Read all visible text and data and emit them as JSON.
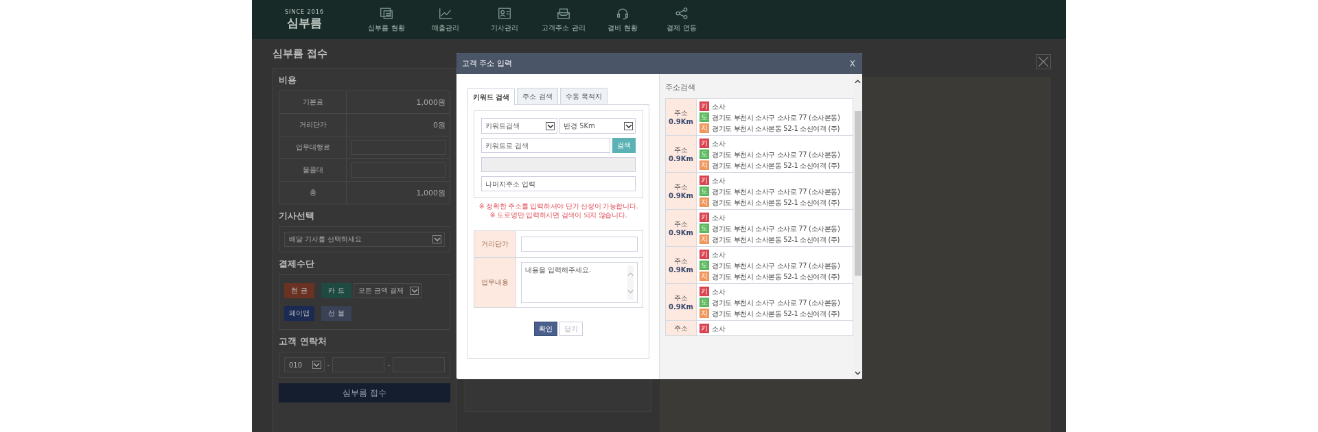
{
  "header": {
    "logo": {
      "since": "SINCE 2016",
      "name": "심부름"
    },
    "nav": [
      {
        "label": "심부름 현황",
        "kind": "board"
      },
      {
        "label": "매출관리",
        "kind": "chart"
      },
      {
        "label": "기사관리",
        "kind": "card"
      },
      {
        "label": "고객주소 관리",
        "kind": "inbox"
      },
      {
        "label": "결비 현황",
        "kind": "headset"
      },
      {
        "label": "결제 연동",
        "kind": "share"
      }
    ]
  },
  "page": {
    "title": "심부름 접수",
    "cost": {
      "heading": "비용",
      "rows": [
        {
          "label": "기본료",
          "kind": "value",
          "value": "1,000원"
        },
        {
          "label": "거리단가",
          "kind": "value",
          "value": "0원"
        },
        {
          "label": "업무대행료",
          "kind": "input"
        },
        {
          "label": "물품대",
          "kind": "input"
        },
        {
          "label": "총",
          "kind": "value",
          "value": "1,000원"
        }
      ]
    },
    "driver": {
      "heading": "기사선택",
      "select": "배달 기사를 선택하세요"
    },
    "payment": {
      "heading": "결제수단",
      "rows": [
        [
          {
            "kind": "button",
            "label": "현 금",
            "color": "#6a3222"
          },
          {
            "kind": "button",
            "label": "카 드",
            "color": "#1f4a42"
          },
          {
            "kind": "select",
            "label": "모든 금액 결제"
          }
        ],
        [
          {
            "kind": "button",
            "label": "페이앱",
            "color": "#1b2a52"
          },
          {
            "kind": "button",
            "label": "선 불",
            "color": "#3a4256"
          }
        ]
      ]
    },
    "contact": {
      "heading": "고객 연락처",
      "prefix": "010",
      "separators": [
        "-",
        "-"
      ]
    },
    "submit": "심부름 접수"
  },
  "modal": {
    "title": "고객 주소 입력",
    "close": "X",
    "tabs": [
      {
        "label": "키워드 검색",
        "selected": true
      },
      {
        "label": "주소 검색",
        "selected": false
      },
      {
        "label": "수동 목적지",
        "selected": false
      }
    ],
    "search": {
      "type_select": "키워드검색",
      "radius_select": "반경 5Km",
      "keyword": {
        "placeholder": "키워드로 검색"
      },
      "search_button": "검색",
      "address_display": {
        "disabled": true
      },
      "detail": {
        "placeholder": "나머지주소 입력"
      }
    },
    "notices": [
      "※ 정확한 주소를 입력하셔야 단가 산정이 가능합니다.",
      "※ 도로명만 입력하시면 검색이 되지 않습니다."
    ],
    "form": [
      {
        "label": "거리단가",
        "kind": "input"
      },
      {
        "label": "업무내용",
        "kind": "textarea",
        "placeholder": "내용을 입력해주세요."
      }
    ],
    "buttons": [
      {
        "label": "확인",
        "kind": "primary"
      },
      {
        "label": "닫기",
        "kind": "secondary"
      }
    ],
    "results": {
      "heading": "주소검색",
      "items": [
        {
          "label": "주소",
          "distance": "0.9Km",
          "lines": [
            {
              "badge": "키",
              "color": "#d9434f",
              "text": "소사"
            },
            {
              "badge": "도",
              "color": "#5cb85c",
              "text": "경기도 부천시 소사구 소사로 77 (소사본동)"
            },
            {
              "badge": "지",
              "color": "#f0955b",
              "text": "경기도 부천시 소사본동 52-1 소신여객 (주)"
            }
          ]
        },
        {
          "label": "주소",
          "distance": "0.9Km",
          "lines": [
            {
              "badge": "키",
              "color": "#d9434f",
              "text": "소사"
            },
            {
              "badge": "도",
              "color": "#5cb85c",
              "text": "경기도 부천시 소사구 소사로 77 (소사본동)"
            },
            {
              "badge": "지",
              "color": "#f0955b",
              "text": "경기도 부천시 소사본동 52-1 소신여객 (주)"
            }
          ]
        },
        {
          "label": "주소",
          "distance": "0.9Km",
          "lines": [
            {
              "badge": "키",
              "color": "#d9434f",
              "text": "소사"
            },
            {
              "badge": "도",
              "color": "#5cb85c",
              "text": "경기도 부천시 소사구 소사로 77 (소사본동)"
            },
            {
              "badge": "지",
              "color": "#f0955b",
              "text": "경기도 부천시 소사본동 52-1 소신여객 (주)"
            }
          ]
        },
        {
          "label": "주소",
          "distance": "0.9Km",
          "lines": [
            {
              "badge": "키",
              "color": "#d9434f",
              "text": "소사"
            },
            {
              "badge": "도",
              "color": "#5cb85c",
              "text": "경기도 부천시 소사구 소사로 77 (소사본동)"
            },
            {
              "badge": "지",
              "color": "#f0955b",
              "text": "경기도 부천시 소사본동 52-1 소신여객 (주)"
            }
          ]
        },
        {
          "label": "주소",
          "distance": "0.9Km",
          "lines": [
            {
              "badge": "키",
              "color": "#d9434f",
              "text": "소사"
            },
            {
              "badge": "도",
              "color": "#5cb85c",
              "text": "경기도 부천시 소사구 소사로 77 (소사본동)"
            },
            {
              "badge": "지",
              "color": "#f0955b",
              "text": "경기도 부천시 소사본동 52-1 소신여객 (주)"
            }
          ]
        },
        {
          "label": "주소",
          "distance": "0.9Km",
          "lines": [
            {
              "badge": "키",
              "color": "#d9434f",
              "text": "소사"
            },
            {
              "badge": "도",
              "color": "#5cb85c",
              "text": "경기도 부천시 소사구 소사로 77 (소사본동)"
            },
            {
              "badge": "지",
              "color": "#f0955b",
              "text": "경기도 부천시 소사본동 52-1 소신여객 (주)"
            }
          ]
        },
        {
          "label": "주소",
          "lines": [
            {
              "badge": "키",
              "color": "#d9434f",
              "text": "소사"
            }
          ]
        }
      ]
    }
  }
}
